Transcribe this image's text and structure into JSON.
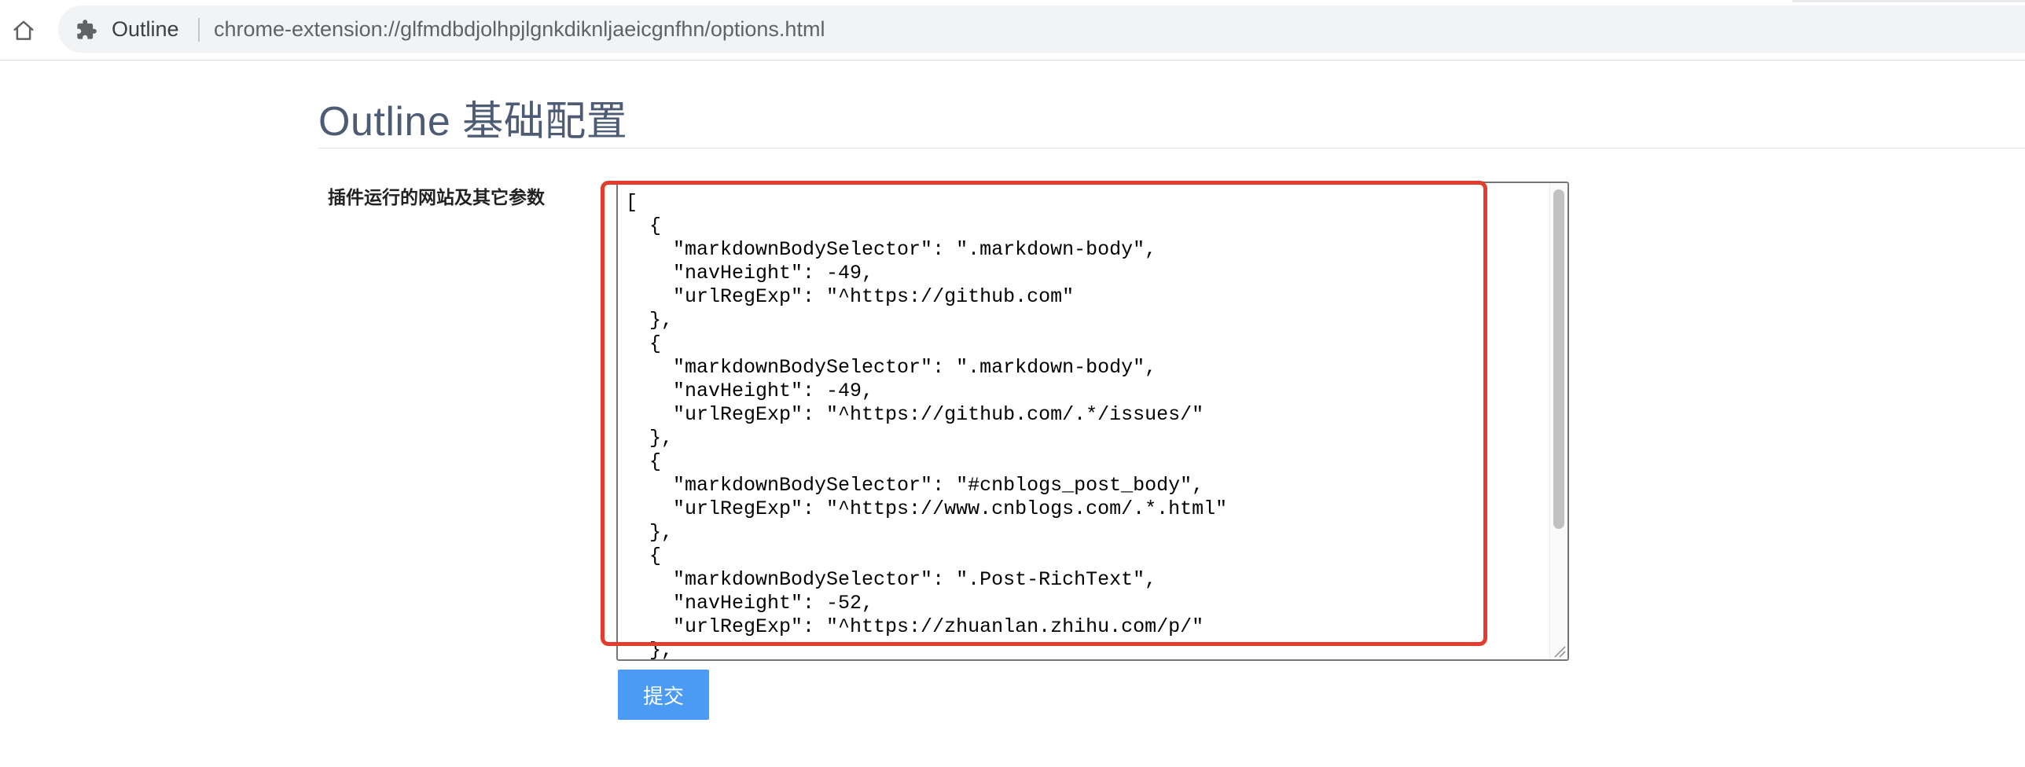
{
  "browser": {
    "extension_chip": "Outline",
    "url": "chrome-extension://glfmdbdjolhpjlgnkdiknljaeicgnfhn/options.html",
    "icons": {
      "home": "home-icon",
      "extension": "puzzle-piece-icon"
    }
  },
  "page": {
    "title": "Outline 基础配置",
    "field_label": "插件运行的网站及其它参数",
    "config_text": "[\n  {\n    \"markdownBodySelector\": \".markdown-body\",\n    \"navHeight\": -49,\n    \"urlRegExp\": \"^https://github.com\"\n  },\n  {\n    \"markdownBodySelector\": \".markdown-body\",\n    \"navHeight\": -49,\n    \"urlRegExp\": \"^https://github.com/.*/issues/\"\n  },\n  {\n    \"markdownBodySelector\": \"#cnblogs_post_body\",\n    \"urlRegExp\": \"^https://www.cnblogs.com/.*.html\"\n  },\n  {\n    \"markdownBodySelector\": \".Post-RichText\",\n    \"navHeight\": -52,\n    \"urlRegExp\": \"^https://zhuanlan.zhihu.com/p/\"\n  },",
    "submit_label": "提交"
  },
  "colors": {
    "title": "#4d5c74",
    "submit_button": "#4b9bf5",
    "highlight_annotation": "#e33b2e"
  }
}
